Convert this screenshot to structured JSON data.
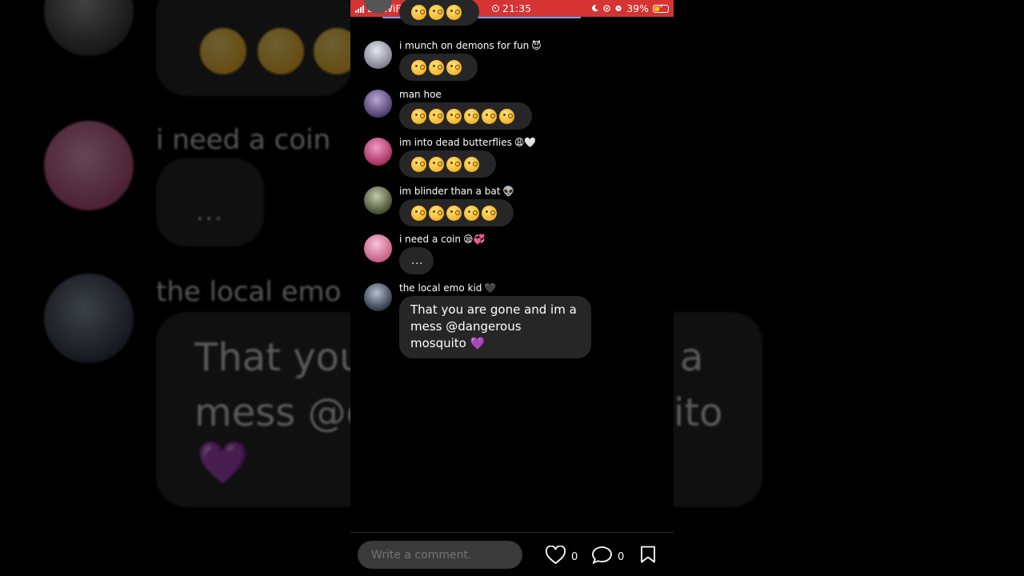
{
  "status_bar": {
    "carrier": "EE WiFiCall",
    "time": "21:35",
    "battery": "39%",
    "battery_level": 0.39
  },
  "comments": [
    {
      "username": "i munch on demons for fun",
      "username_emoji": "😈",
      "emoji_count": 3,
      "avatar_color": "#a9a9b8"
    },
    {
      "username": "man hoe",
      "username_emoji": "",
      "emoji_count": 6,
      "avatar_color": "#6f5a8a"
    },
    {
      "username": "im into dead butterflies",
      "username_emoji": "😩🤍",
      "emoji_count": 4,
      "avatar_color": "#c24b7a"
    },
    {
      "username": "im blinder than a bat",
      "username_emoji": "👽",
      "emoji_count": 5,
      "avatar_color": "#6d7559"
    },
    {
      "username": "i need a coin",
      "username_emoji": "😪💞",
      "text": "...",
      "avatar_color": "#d98aa5"
    },
    {
      "username": "the local emo kid",
      "username_emoji": "🖤",
      "text": "That you are gone and im a mess @dangerous mosquito 💜",
      "avatar_color": "#4a5566"
    }
  ],
  "composer": {
    "placeholder": "Write a comment.",
    "likes": "0",
    "replies": "0"
  },
  "background": {
    "text_need_coin": "i need a coin",
    "text_emo": "the local emo",
    "dots": "...",
    "big_line1": "That you",
    "big_line2": "mess @d",
    "right_a": "a",
    "right_ito": "ito",
    "heart": "💜"
  }
}
